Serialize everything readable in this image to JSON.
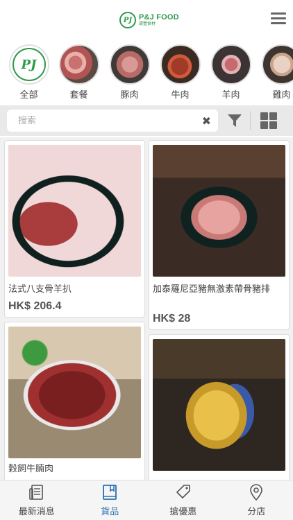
{
  "header": {
    "logo_mark": "PJ",
    "logo_text": "P&J FOOD",
    "logo_subtext": "環豐食材"
  },
  "categories": [
    {
      "label": "全部",
      "icon": "pj-logo"
    },
    {
      "label": "套餐",
      "icon": "meat-photo"
    },
    {
      "label": "豚肉",
      "icon": "meat-photo"
    },
    {
      "label": "牛肉",
      "icon": "meat-photo"
    },
    {
      "label": "羊肉",
      "icon": "meat-photo"
    },
    {
      "label": "雞肉",
      "icon": "meat-photo"
    }
  ],
  "search": {
    "placeholder": "搜索",
    "value": ""
  },
  "products": [
    {
      "name": "法式八支骨羊扒",
      "price": "HK$ 206.4"
    },
    {
      "name": "加泰羅尼亞豬無激素帶骨豬排",
      "price": "HK$ 28"
    },
    {
      "name": "穀飼牛腩肉",
      "price": ""
    },
    {
      "name": "",
      "price": ""
    }
  ],
  "bottom_nav": [
    {
      "label": "最新消息",
      "icon": "news-icon",
      "active": false
    },
    {
      "label": "貨品",
      "icon": "book-icon",
      "active": true
    },
    {
      "label": "搶優惠",
      "icon": "tag-icon",
      "active": false
    },
    {
      "label": "分店",
      "icon": "location-pin-icon",
      "active": false
    }
  ],
  "colors": {
    "brand_green": "#2e9b4a",
    "active_blue": "#2a6fb0"
  }
}
